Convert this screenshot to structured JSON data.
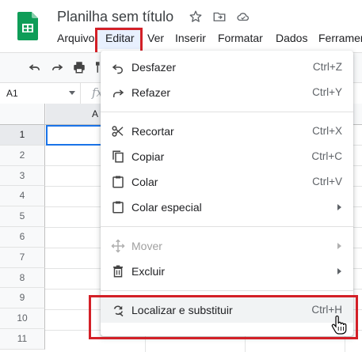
{
  "app": {
    "doc_title": "Planilha sem título",
    "brand_color": "#0f9d58"
  },
  "menubar": {
    "items": [
      {
        "label": "Arquivo"
      },
      {
        "label": "Editar",
        "active": true
      },
      {
        "label": "Ver"
      },
      {
        "label": "Inserir"
      },
      {
        "label": "Formatar"
      },
      {
        "label": "Dados"
      },
      {
        "label": "Ferramen"
      }
    ]
  },
  "title_icons": [
    "star-icon",
    "move-to-folder-icon",
    "cloud-status-icon"
  ],
  "toolbar": {
    "icons": [
      "undo-icon",
      "redo-icon",
      "print-icon",
      "paint-format-icon"
    ]
  },
  "formula_bar": {
    "name_box": "A1",
    "fx_symbol": "fx"
  },
  "grid": {
    "column_headers": [
      "A"
    ],
    "row_headers": [
      "1",
      "2",
      "3",
      "4",
      "5",
      "6",
      "7",
      "8",
      "9",
      "10",
      "11"
    ],
    "selected_cell": "A1"
  },
  "edit_menu": {
    "items": [
      {
        "label": "Desfazer",
        "shortcut": "Ctrl+Z",
        "icon": "undo-icon"
      },
      {
        "label": "Refazer",
        "shortcut": "Ctrl+Y",
        "icon": "redo-icon"
      },
      {
        "label": "Recortar",
        "shortcut": "Ctrl+X",
        "icon": "cut-icon"
      },
      {
        "label": "Copiar",
        "shortcut": "Ctrl+C",
        "icon": "copy-icon"
      },
      {
        "label": "Colar",
        "shortcut": "Ctrl+V",
        "icon": "paste-icon"
      },
      {
        "label": "Colar especial",
        "shortcut": "",
        "icon": "paste-special-icon",
        "submenu": true
      },
      {
        "label": "Mover",
        "shortcut": "",
        "icon": "move-icon",
        "submenu": true,
        "disabled": true
      },
      {
        "label": "Excluir",
        "shortcut": "",
        "icon": "delete-icon",
        "submenu": true
      },
      {
        "label": "Localizar e substituir",
        "shortcut": "Ctrl+H",
        "icon": "find-replace-icon",
        "hovered": true
      }
    ]
  },
  "colors": {
    "highlight": "#d32027",
    "selection": "#1a73e8",
    "menu_active_bg": "#e8f0fe"
  }
}
